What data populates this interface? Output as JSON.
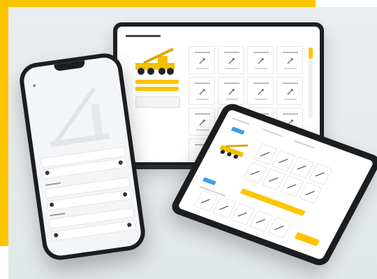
{
  "colors": {
    "accent_yellow": "#ffc400",
    "badge_blue": "#3aa0e8",
    "device_frame": "#1b1d20",
    "backdrop": "#e6eaed"
  },
  "icons": {
    "crane": "crane-icon",
    "tile": "crane-config-icon",
    "scroll": "scroll-indicator"
  }
}
